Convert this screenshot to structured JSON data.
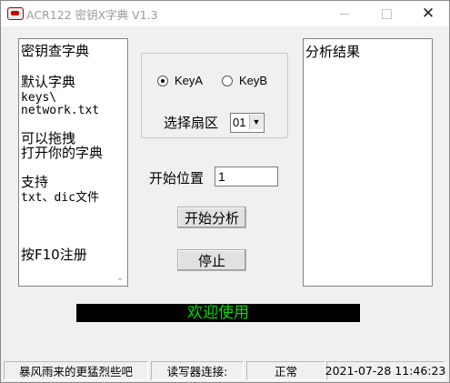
{
  "window": {
    "title": "ACR122 密钥X字典 V1.3",
    "close_glyph": "✕"
  },
  "dictionary": {
    "lines": [
      "密钥查字典",
      "默认字典",
      "keys\\",
      "network.txt",
      "可以拖拽",
      "打开你的字典",
      "支持",
      "txt、dic文件",
      "按F10注册"
    ]
  },
  "key_group": {
    "key_a_label": "KeyA",
    "key_b_label": "KeyB",
    "selected": "KeyA",
    "sector_label": "选择扇区",
    "sector_value": "01"
  },
  "start_position": {
    "label": "开始位置",
    "value": "1"
  },
  "buttons": {
    "start": "开始分析",
    "stop": "停止"
  },
  "result": {
    "title": "分析结果"
  },
  "marquee": {
    "text": "欢迎使用",
    "text_color": "#00e000",
    "bg_color": "#000000"
  },
  "status_bar": {
    "slogan": "暴风雨来的更猛烈些吧",
    "reader_label": "读写器连接:",
    "reader_status": "正常",
    "datetime": "2021-07-28 11:46:23"
  },
  "icons": {
    "app": "card-reader-icon",
    "dropdown": "chevron-down-icon",
    "scroll_down": "scroll-down-icon"
  }
}
